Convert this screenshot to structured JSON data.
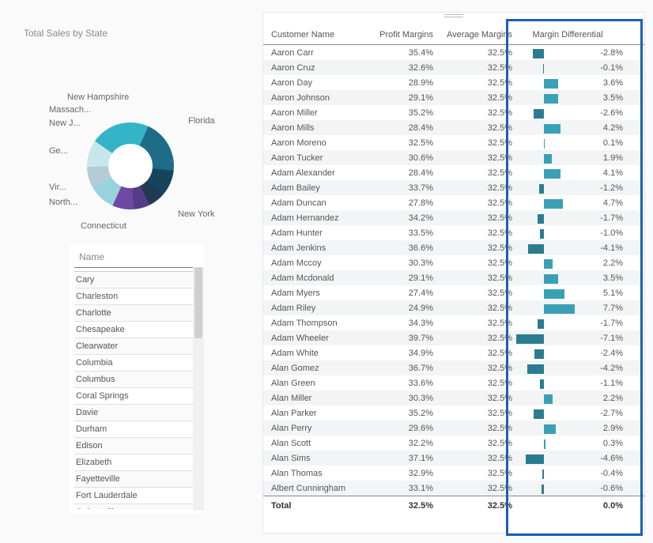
{
  "donut": {
    "title": "Total Sales by State",
    "labels": [
      "New Hampshire",
      "Massach...",
      "New J...",
      "Ge...",
      "Vir...",
      "North...",
      "Connecticut",
      "New York",
      "Florida"
    ]
  },
  "slicer": {
    "header": "Name",
    "items": [
      "Cary",
      "Charleston",
      "Charlotte",
      "Chesapeake",
      "Clearwater",
      "Columbia",
      "Columbus",
      "Coral Springs",
      "Davie",
      "Durham",
      "Edison",
      "Elizabeth",
      "Fayetteville",
      "Fort Lauderdale",
      "Gainesville"
    ]
  },
  "table": {
    "headers": {
      "name": "Customer Name",
      "pm": "Profit Margins",
      "am": "Average Margins",
      "md": "Margin Differential"
    },
    "rows": [
      {
        "name": "Aaron Carr",
        "pm": "35.4%",
        "am": "32.5%",
        "md": "-2.8%",
        "v": -2.8
      },
      {
        "name": "Aaron Cruz",
        "pm": "32.6%",
        "am": "32.5%",
        "md": "-0.1%",
        "v": -0.1
      },
      {
        "name": "Aaron Day",
        "pm": "28.9%",
        "am": "32.5%",
        "md": "3.6%",
        "v": 3.6
      },
      {
        "name": "Aaron Johnson",
        "pm": "29.1%",
        "am": "32.5%",
        "md": "3.5%",
        "v": 3.5
      },
      {
        "name": "Aaron Miller",
        "pm": "35.2%",
        "am": "32.5%",
        "md": "-2.6%",
        "v": -2.6
      },
      {
        "name": "Aaron Mills",
        "pm": "28.4%",
        "am": "32.5%",
        "md": "4.2%",
        "v": 4.2
      },
      {
        "name": "Aaron Moreno",
        "pm": "32.5%",
        "am": "32.5%",
        "md": "0.1%",
        "v": 0.1
      },
      {
        "name": "Aaron Tucker",
        "pm": "30.6%",
        "am": "32.5%",
        "md": "1.9%",
        "v": 1.9
      },
      {
        "name": "Adam Alexander",
        "pm": "28.4%",
        "am": "32.5%",
        "md": "4.1%",
        "v": 4.1
      },
      {
        "name": "Adam Bailey",
        "pm": "33.7%",
        "am": "32.5%",
        "md": "-1.2%",
        "v": -1.2
      },
      {
        "name": "Adam Duncan",
        "pm": "27.8%",
        "am": "32.5%",
        "md": "4.7%",
        "v": 4.7
      },
      {
        "name": "Adam Hernandez",
        "pm": "34.2%",
        "am": "32.5%",
        "md": "-1.7%",
        "v": -1.7
      },
      {
        "name": "Adam Hunter",
        "pm": "33.5%",
        "am": "32.5%",
        "md": "-1.0%",
        "v": -1.0
      },
      {
        "name": "Adam Jenkins",
        "pm": "36.6%",
        "am": "32.5%",
        "md": "-4.1%",
        "v": -4.1
      },
      {
        "name": "Adam Mccoy",
        "pm": "30.3%",
        "am": "32.5%",
        "md": "2.2%",
        "v": 2.2
      },
      {
        "name": "Adam Mcdonald",
        "pm": "29.1%",
        "am": "32.5%",
        "md": "3.5%",
        "v": 3.5
      },
      {
        "name": "Adam Myers",
        "pm": "27.4%",
        "am": "32.5%",
        "md": "5.1%",
        "v": 5.1
      },
      {
        "name": "Adam Riley",
        "pm": "24.9%",
        "am": "32.5%",
        "md": "7.7%",
        "v": 7.7
      },
      {
        "name": "Adam Thompson",
        "pm": "34.3%",
        "am": "32.5%",
        "md": "-1.7%",
        "v": -1.7
      },
      {
        "name": "Adam Wheeler",
        "pm": "39.7%",
        "am": "32.5%",
        "md": "-7.1%",
        "v": -7.1
      },
      {
        "name": "Adam White",
        "pm": "34.9%",
        "am": "32.5%",
        "md": "-2.4%",
        "v": -2.4
      },
      {
        "name": "Alan Gomez",
        "pm": "36.7%",
        "am": "32.5%",
        "md": "-4.2%",
        "v": -4.2
      },
      {
        "name": "Alan Green",
        "pm": "33.6%",
        "am": "32.5%",
        "md": "-1.1%",
        "v": -1.1
      },
      {
        "name": "Alan Miller",
        "pm": "30.3%",
        "am": "32.5%",
        "md": "2.2%",
        "v": 2.2
      },
      {
        "name": "Alan Parker",
        "pm": "35.2%",
        "am": "32.5%",
        "md": "-2.7%",
        "v": -2.7
      },
      {
        "name": "Alan Perry",
        "pm": "29.6%",
        "am": "32.5%",
        "md": "2.9%",
        "v": 2.9
      },
      {
        "name": "Alan Scott",
        "pm": "32.2%",
        "am": "32.5%",
        "md": "0.3%",
        "v": 0.3
      },
      {
        "name": "Alan Sims",
        "pm": "37.1%",
        "am": "32.5%",
        "md": "-4.6%",
        "v": -4.6
      },
      {
        "name": "Alan Thomas",
        "pm": "32.9%",
        "am": "32.5%",
        "md": "-0.4%",
        "v": -0.4
      },
      {
        "name": "Albert Cunningham",
        "pm": "33.1%",
        "am": "32.5%",
        "md": "-0.6%",
        "v": -0.6
      }
    ],
    "total": {
      "label": "Total",
      "pm": "32.5%",
      "am": "32.5%",
      "md": "0.0%"
    }
  },
  "chart_data": {
    "type": "pie",
    "title": "Total Sales by State",
    "series": [
      {
        "name": "Florida",
        "value": 22
      },
      {
        "name": "New York",
        "value": 20
      },
      {
        "name": "Connecticut",
        "value": 10
      },
      {
        "name": "North...",
        "value": 6
      },
      {
        "name": "Vir...",
        "value": 6
      },
      {
        "name": "Ge...",
        "value": 8
      },
      {
        "name": "New J...",
        "value": 10
      },
      {
        "name": "Massach...",
        "value": 8
      },
      {
        "name": "New Hampshire",
        "value": 10
      }
    ],
    "note": "values are estimated share percentages; donut hole present"
  }
}
